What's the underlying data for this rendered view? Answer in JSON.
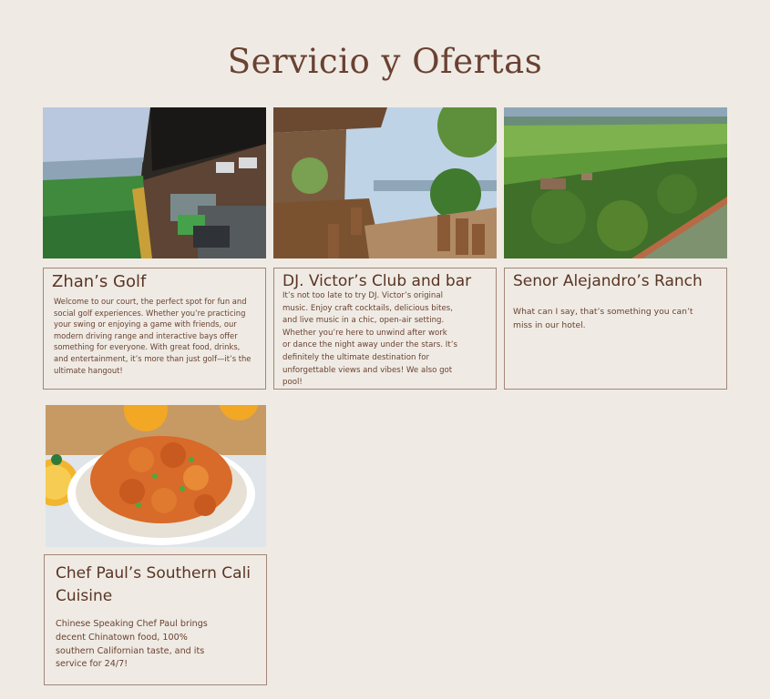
{
  "page": {
    "title": "Servicio y Ofertas"
  },
  "cards": [
    {
      "title": "Zhan’s Golf",
      "description": "Welcome to our court, the perfect spot for fun and social golf experiences. Whether you’re practicing your swing or enjoying a game with friends, our modern driving range and interactive bays offer something for everyone. With great food, drinks, and entertainment, it’s more than just golf—it’s the ultimate hangout!"
    },
    {
      "title": "DJ. Victor’s Club and bar",
      "description": "It’s not too late to try DJ. Victor’s original music. Enjoy craft cocktails, delicious bites, and live music in a chic, open-air setting. Whether you’re here to unwind after work or dance the night away under the stars. It’s definitely the ultimate destination for unforgettable views and vibes! We also got pool!"
    },
    {
      "title": "Senor Alejandro’s Ranch",
      "description": "What can I say, that’s something you can’t miss in our hotel."
    },
    {
      "title": "Chef Paul’s Southern Cali Cuisine",
      "description": "Chinese Speaking Chef Paul brings decent Chinatown food, 100% southern Californian taste, and its service for 24/7!"
    }
  ],
  "colors": {
    "background": "#efebe4",
    "text": "#5a3424",
    "border": "#a3857a"
  }
}
